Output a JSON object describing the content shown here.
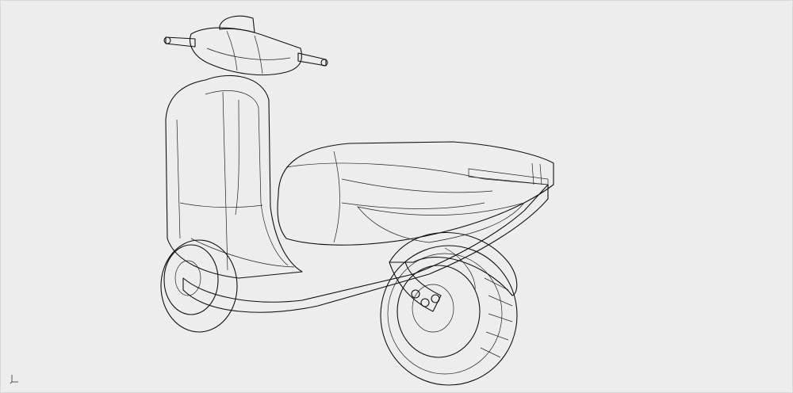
{
  "viewport": {
    "background": "#ededed",
    "shading": {
      "highlight": "#ffffff",
      "mid": "#b8bdf0",
      "deep": "#3f3fd8",
      "edge": "#111111"
    }
  },
  "model": {
    "icon": "scooter-cad-model"
  },
  "axis_indicator": {
    "icon": "axis-triad-icon"
  }
}
